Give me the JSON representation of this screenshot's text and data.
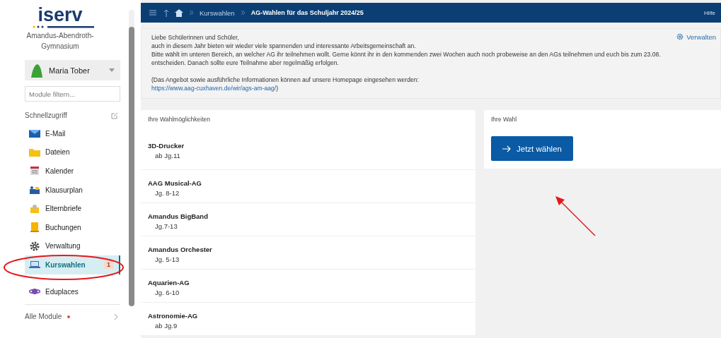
{
  "sidebar": {
    "logo": "iserv",
    "school": "Amandus-Abendroth-Gymnasium",
    "user": "Maria Tober",
    "filter": {
      "placeholder": "Module filtern..."
    },
    "quick_access": "Schnellzugriff",
    "items": [
      {
        "label": "E-Mail",
        "selected": false
      },
      {
        "label": "Dateien",
        "selected": false
      },
      {
        "label": "Kalender",
        "selected": false
      },
      {
        "label": "Klausurplan",
        "selected": false
      },
      {
        "label": "Elternbriefe",
        "selected": false
      },
      {
        "label": "Buchungen",
        "selected": false
      },
      {
        "label": "Verwaltung",
        "selected": false
      },
      {
        "label": "Kurswahlen",
        "selected": true,
        "badge": "1"
      },
      {
        "label": "Eduplaces",
        "selected": false
      }
    ],
    "all_modules": "Alle Module"
  },
  "header": {
    "breadcrumbs": [
      "Kurswahlen",
      "AG-Wahlen für das Schuljahr 2024/25"
    ],
    "help": "Hilfe"
  },
  "intro": {
    "manage": "Verwalten",
    "lines": [
      "Liebe Schülerinnen und Schüler,",
      "auch in diesem Jahr bieten wir wieder viele spannenden und interessante Arbeitsgemeinschaft an.",
      "Bitte wählt im unteren Bereich, an welcher AG ihr teilnehmen wollt. Gerne könnt ihr in den kommenden zwei Wochen auch noch probeweise an den AGs teilnehmen und euch bis zum 23.08.",
      "entscheiden. Danach sollte eure Teilnahme aber regelmäßig erfolgen."
    ],
    "info": {
      "text": "(Das Angebot sowie ausführliche Informationen können auf unsere Homepage eingesehen werden:",
      "link": "https://www.aag-cuxhaven.de/wir/ags-am-aag/",
      "after": ")"
    }
  },
  "options": {
    "title": "Ihre Wahlmöglichkeiten",
    "items": [
      {
        "name": "3D-Drucker",
        "grades": "ab Jg.11"
      },
      {
        "name": "AAG Musical-AG",
        "grades": "Jg. 8-12"
      },
      {
        "name": "Amandus BigBand",
        "grades": "Jg.7-13"
      },
      {
        "name": "Amandus Orchester",
        "grades": "Jg. 5-13"
      },
      {
        "name": "Aquarien-AG",
        "grades": "Jg. 6-10"
      },
      {
        "name": "Astronomie-AG",
        "grades": "ab Jg.9"
      }
    ]
  },
  "choice": {
    "title": "Ihre Wahl",
    "button": "Jetzt wählen"
  }
}
